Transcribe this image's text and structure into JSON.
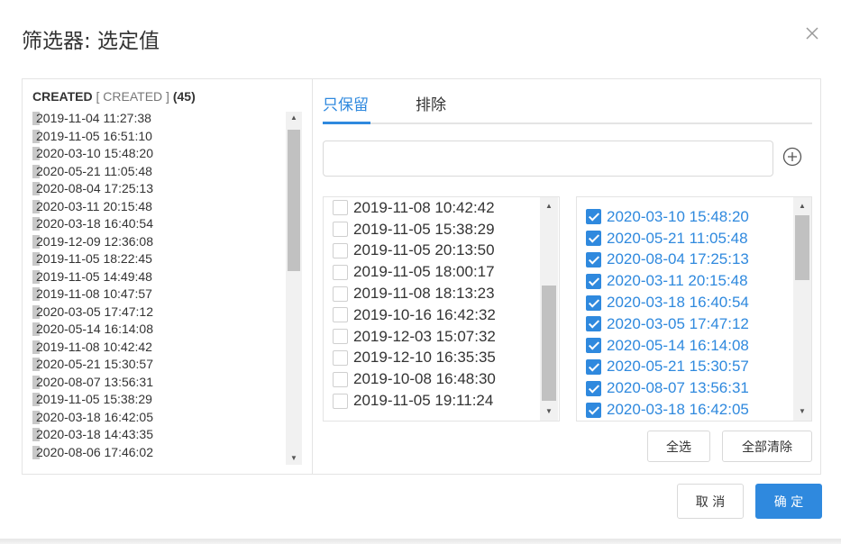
{
  "dialog": {
    "title": "筛选器: 选定值",
    "close_icon": "close-icon"
  },
  "left": {
    "field_name": "CREATED",
    "field_bracket": "[ CREATED ]",
    "count": "(45)",
    "values": [
      "2019-11-04 11:27:38",
      "2019-11-05 16:51:10",
      "2020-03-10 15:48:20",
      "2020-05-21 11:05:48",
      "2020-08-04 17:25:13",
      "2020-03-11 20:15:48",
      "2020-03-18 16:40:54",
      "2019-12-09 12:36:08",
      "2019-11-05 18:22:45",
      "2019-11-05 14:49:48",
      "2019-11-08 10:47:57",
      "2020-03-05 17:47:12",
      "2020-05-14 16:14:08",
      "2019-11-08 10:42:42",
      "2020-05-21 15:30:57",
      "2020-08-07 13:56:31",
      "2019-11-05 15:38:29",
      "2020-03-18 16:42:05",
      "2020-03-18 14:43:35",
      "2020-08-06 17:46:02"
    ]
  },
  "tabs": {
    "keep": "只保留",
    "exclude": "排除"
  },
  "search": {
    "value": "",
    "placeholder": ""
  },
  "available": [
    "2019-11-08 10:42:42",
    "2019-11-05 15:38:29",
    "2019-11-05 20:13:50",
    "2019-11-05 18:00:17",
    "2019-11-08 18:13:23",
    "2019-10-16 16:42:32",
    "2019-12-03 15:07:32",
    "2019-12-10 16:35:35",
    "2019-10-08 16:48:30",
    "2019-11-05 19:11:24"
  ],
  "selected": [
    "2020-03-10 15:48:20",
    "2020-05-21 11:05:48",
    "2020-08-04 17:25:13",
    "2020-03-11 20:15:48",
    "2020-03-18 16:40:54",
    "2020-03-05 17:47:12",
    "2020-05-14 16:14:08",
    "2020-05-21 15:30:57",
    "2020-08-07 13:56:31",
    "2020-03-18 16:42:05"
  ],
  "buttons": {
    "select_all": "全选",
    "clear_all": "全部清除",
    "cancel": "取 消",
    "confirm": "确 定"
  },
  "colors": {
    "accent": "#2f89de"
  }
}
